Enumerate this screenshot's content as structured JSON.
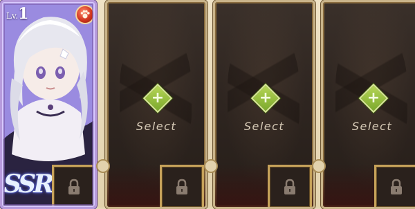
{
  "hero_card": {
    "level_prefix": "Lv.",
    "level_value": "1",
    "rarity": "SSR",
    "element_icon": "paw-element-icon",
    "accent_color": "#8e7fd0"
  },
  "empty_slots": [
    {
      "label": "Select",
      "action_icon": "plus-icon"
    },
    {
      "label": "Select",
      "action_icon": "plus-icon"
    },
    {
      "label": "Select",
      "action_icon": "plus-icon"
    }
  ],
  "lock_icon": "lock-icon",
  "colors": {
    "frame_gold": "#c6a25a",
    "select_text": "#d8ccb8",
    "plus_green": "#7ba82c",
    "element_red": "#d2361f"
  }
}
